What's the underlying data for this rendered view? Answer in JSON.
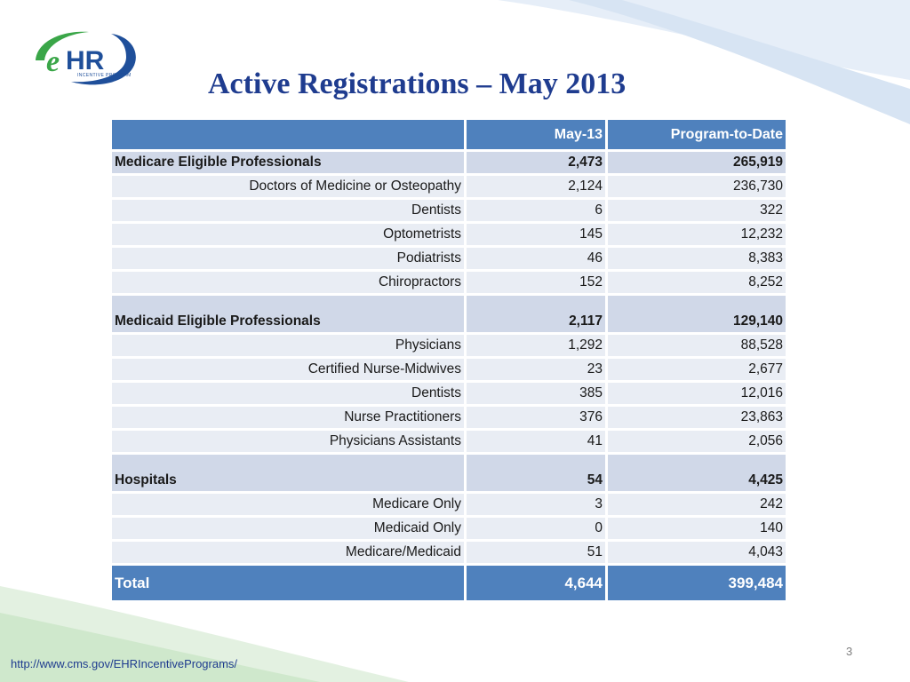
{
  "page": {
    "title": "Active Registrations – May 2013",
    "page_number": "3",
    "url": "http://www.cms.gov/EHRIncentivePrograms/"
  },
  "logo": {
    "text": "eHR",
    "subtext": "INCENTIVE PROGRAM",
    "colors": {
      "green": "#3aa648",
      "blue": "#1f4f9a"
    }
  },
  "table": {
    "headers": {
      "col1": "",
      "col2": "May-13",
      "col3": "Program-to-Date"
    },
    "medicare": {
      "label": "Medicare Eligible Professionals",
      "may": "2,473",
      "ptd": "265,919",
      "rows": [
        {
          "label": "Doctors of Medicine or Osteopathy",
          "may": "2,124",
          "ptd": "236,730"
        },
        {
          "label": "Dentists",
          "may": "6",
          "ptd": "322"
        },
        {
          "label": "Optometrists",
          "may": "145",
          "ptd": "12,232"
        },
        {
          "label": "Podiatrists",
          "may": "46",
          "ptd": "8,383"
        },
        {
          "label": "Chiropractors",
          "may": "152",
          "ptd": "8,252"
        }
      ]
    },
    "medicaid": {
      "label": "Medicaid Eligible Professionals",
      "may": "2,117",
      "ptd": "129,140",
      "rows": [
        {
          "label": "Physicians",
          "may": "1,292",
          "ptd": "88,528"
        },
        {
          "label": "Certified Nurse-Midwives",
          "may": "23",
          "ptd": "2,677"
        },
        {
          "label": "Dentists",
          "may": "385",
          "ptd": "12,016"
        },
        {
          "label": "Nurse Practitioners",
          "may": "376",
          "ptd": "23,863"
        },
        {
          "label": "Physicians Assistants",
          "may": "41",
          "ptd": "2,056"
        }
      ]
    },
    "hospitals": {
      "label": "Hospitals",
      "may": "54",
      "ptd": "4,425",
      "rows": [
        {
          "label": "Medicare Only",
          "may": "3",
          "ptd": "242"
        },
        {
          "label": "Medicaid Only",
          "may": "0",
          "ptd": "140"
        },
        {
          "label": "Medicare/Medicaid",
          "may": "51",
          "ptd": "4,043"
        }
      ]
    },
    "total": {
      "label": "Total",
      "may": "4,644",
      "ptd": "399,484"
    }
  },
  "colors": {
    "header_fill": "#4f81bd",
    "group_fill": "#d0d8e8",
    "row_fill": "#e9edf4",
    "title_color": "#1f3c8f"
  }
}
